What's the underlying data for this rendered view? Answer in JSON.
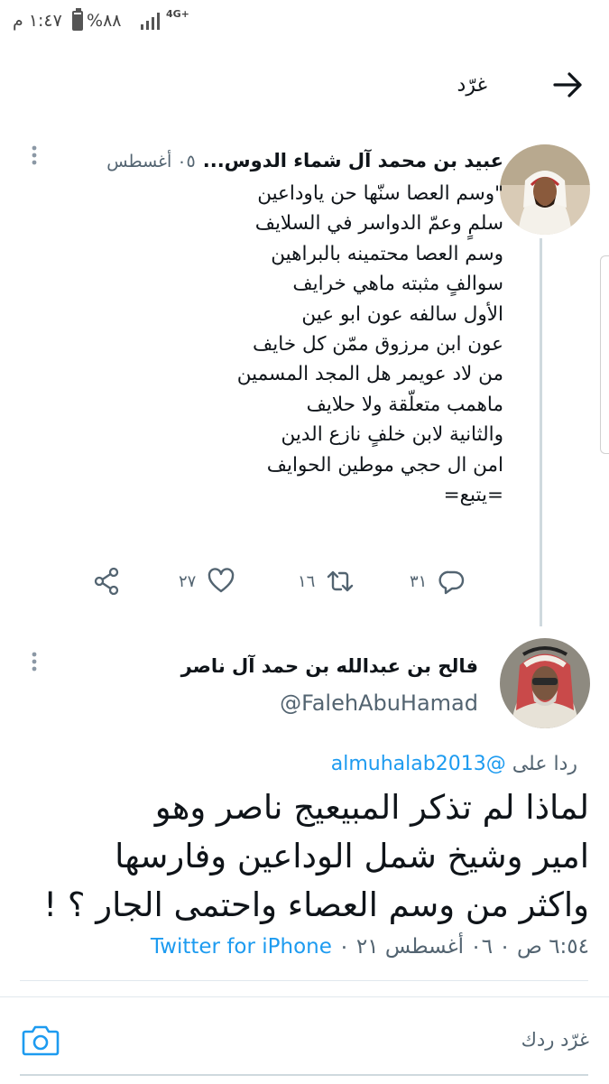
{
  "status_bar": {
    "time": "١:٤٧ م",
    "battery": "%٨٨",
    "battery_level": 0.88,
    "network": "4G+"
  },
  "header": {
    "title": "غرّد"
  },
  "tweet_prev": {
    "name": "عبيد بن محمد آل شماء الدوس...",
    "date": "٠٥ أغسطس",
    "lines": [
      "\"وسم العصا سنّها حن ياوداعين",
      "سلمٍ وعمّ الدواسر في السلايف",
      "وسم العصا محتمينه بالبراهين",
      "سوالفٍ مثبته ماهي خرايف",
      "الأول سالفه عون ابو عين",
      "عون ابن مرزوق ممّن كل خايف",
      "من لاد عويمر هل المجد المسمين",
      "ماهمب متعلّقة ولا حلايف",
      "والثانية لابن خلفٍ نازع الدين",
      "امن ال حجي موطين الحوايف",
      "=يتبع="
    ],
    "replies": "٣١",
    "retweets": "١٦",
    "likes": "٢٧"
  },
  "tweet_main": {
    "name": "فالح بن عبدالله بن حمد آل ناصر",
    "handle": "@FalehAbuHamad",
    "reply_prefix": "ردا على",
    "reply_to": "@almuhalab2013",
    "lines": [
      "لماذا لم تذكر المبيعيج ناصر وهو",
      "امير وشيخ شمل الوداعين وفارسها",
      "واكثر من وسم العصاء واحتمى الجار ؟ !"
    ],
    "timestamp": "٦:٥٤ ص ٠ ٠٦ أغسطس ٢١ ٠",
    "source": "Twitter for iPhone"
  },
  "compose": {
    "placeholder": "غرّد ردك"
  },
  "colors": {
    "accent": "#1d9bf0",
    "muted": "#536471"
  }
}
